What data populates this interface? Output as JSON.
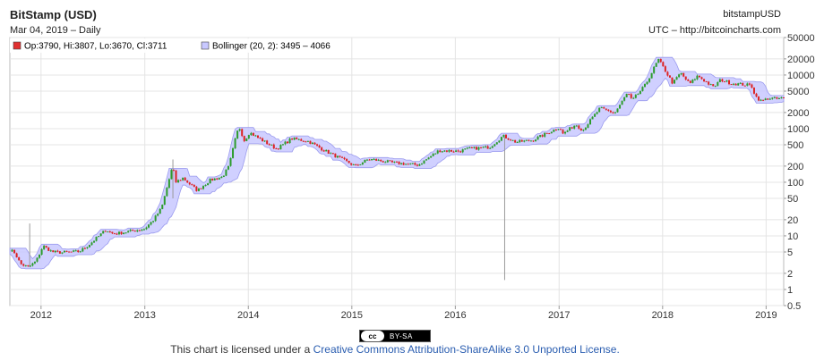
{
  "header": {
    "title": "BitStamp (USD)",
    "subtitle": "Mar 04, 2019 – Daily",
    "symbol": "bitstampUSD",
    "source": "UTC – http://bitcoincharts.com"
  },
  "legend": {
    "ohlc": "Op:3790, Hi:3807, Lo:3670, Cl:3711",
    "bollinger": "Bollinger (20, 2): 3495 – 4066"
  },
  "footer": {
    "badge_cc": "cc",
    "badge_text": "BY-SA",
    "license_prefix": "This chart is licensed under a ",
    "license_link": "Creative Commons Attribution-ShareAlike 3.0 Unported License."
  },
  "colors": {
    "up": "#2c9c2c",
    "down": "#dd2222",
    "band_fill": "#c8c8ff",
    "band_stroke": "#9a9aee",
    "grid": "#e4e4e4",
    "spike": "#9a9a9a"
  },
  "chart_data": {
    "type": "line",
    "title": "BitStamp (USD)",
    "scale": "log",
    "x_tick_labels": [
      "2012",
      "2013",
      "2014",
      "2015",
      "2016",
      "2017",
      "2018",
      "2019"
    ],
    "y_tick_labels": [
      "0.5",
      "1",
      "2",
      "5",
      "10",
      "20",
      "50",
      "100",
      "200",
      "500",
      "1000",
      "2000",
      "5000",
      "10000",
      "20000",
      "50000"
    ],
    "ylim": [
      0.5,
      50000
    ],
    "xlim": [
      "2011-09-13",
      "2019-03-04"
    ],
    "grid": true,
    "legend_position": "top-left",
    "series": [
      {
        "name": "",
        "x": [
          "2011-09-13",
          "2011-10-01",
          "2011-10-20",
          "2011-11-18",
          "2011-12-15",
          "2012-01-08",
          "2012-02-10",
          "2012-03-15",
          "2012-05-15",
          "2012-06-15",
          "2012-08-17",
          "2012-09-10",
          "2012-10-15",
          "2012-11-20",
          "2012-12-31",
          "2013-02-01",
          "2013-03-01",
          "2013-04-09",
          "2013-04-20",
          "2013-05-15",
          "2013-07-05",
          "2013-08-20",
          "2013-10-01",
          "2013-10-25",
          "2013-11-18",
          "2013-11-29",
          "2013-12-18",
          "2014-01-05",
          "2014-02-25",
          "2014-04-11",
          "2014-06-03",
          "2014-08-01",
          "2014-10-01",
          "2015-01-14",
          "2015-03-01",
          "2015-06-01",
          "2015-08-24",
          "2015-11-04",
          "2016-01-15",
          "2016-02-15",
          "2016-05-01",
          "2016-06-17",
          "2016-08-02",
          "2016-10-01",
          "2017-01-04",
          "2017-01-12",
          "2017-03-01",
          "2017-03-25",
          "2017-05-25",
          "2017-07-16",
          "2017-08-31",
          "2017-09-15",
          "2017-11-01",
          "2017-12-17",
          "2018-02-06",
          "2018-03-05",
          "2018-04-06",
          "2018-05-05",
          "2018-06-29",
          "2018-07-25",
          "2018-09-01",
          "2018-11-10",
          "2018-11-25",
          "2018-12-15",
          "2019-01-10",
          "2019-02-08",
          "2019-03-04"
        ],
        "y": [
          5.5,
          4.8,
          3.0,
          2.6,
          3.4,
          6.5,
          5.0,
          4.9,
          5.1,
          6.6,
          13,
          11,
          11.5,
          12.5,
          13.5,
          20,
          33,
          200,
          100,
          120,
          70,
          110,
          125,
          200,
          700,
          1100,
          600,
          850,
          580,
          420,
          650,
          580,
          380,
          200,
          270,
          230,
          210,
          390,
          380,
          420,
          450,
          730,
          560,
          610,
          1080,
          780,
          1200,
          930,
          2400,
          1950,
          4700,
          3300,
          6500,
          19500,
          7000,
          11000,
          6800,
          9700,
          5900,
          8200,
          7000,
          6400,
          4000,
          3250,
          3700,
          3600,
          3711
        ]
      }
    ],
    "annotations": [
      {
        "type": "spike",
        "x": "2011-11-22",
        "low": 2.6,
        "high": 17
      },
      {
        "type": "spike",
        "x": "2016-06-23",
        "low": 1.5,
        "high": 700
      },
      {
        "type": "spike",
        "x": "2013-04-10",
        "low": 50,
        "high": 266
      }
    ]
  }
}
